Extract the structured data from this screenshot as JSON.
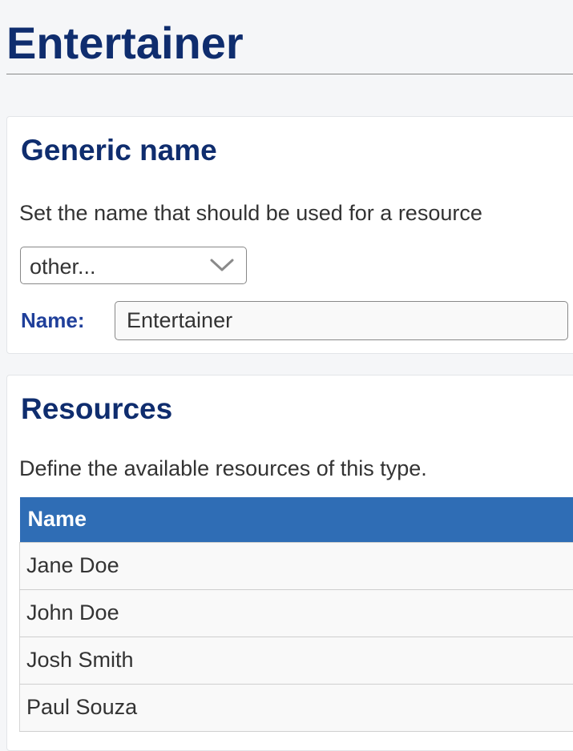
{
  "page": {
    "title": "Entertainer"
  },
  "generic_name": {
    "heading": "Generic name",
    "description": "Set the name that should be used for a resource",
    "select": {
      "selected": "other..."
    },
    "name_label": "Name:",
    "name_value": "Entertainer"
  },
  "resources": {
    "heading": "Resources",
    "description": "Define the available resources of this type.",
    "table": {
      "columns": [
        "Name"
      ],
      "rows": [
        [
          "Jane Doe"
        ],
        [
          "John Doe"
        ],
        [
          "Josh Smith"
        ],
        [
          "Paul Souza"
        ]
      ]
    }
  },
  "colors": {
    "heading": "#0f2d6e",
    "label": "#1f3f9a",
    "table_header_bg": "#2f6db5",
    "page_bg": "#f5f6f8"
  },
  "icons": {
    "select_chevron": "chevron-down-icon"
  }
}
